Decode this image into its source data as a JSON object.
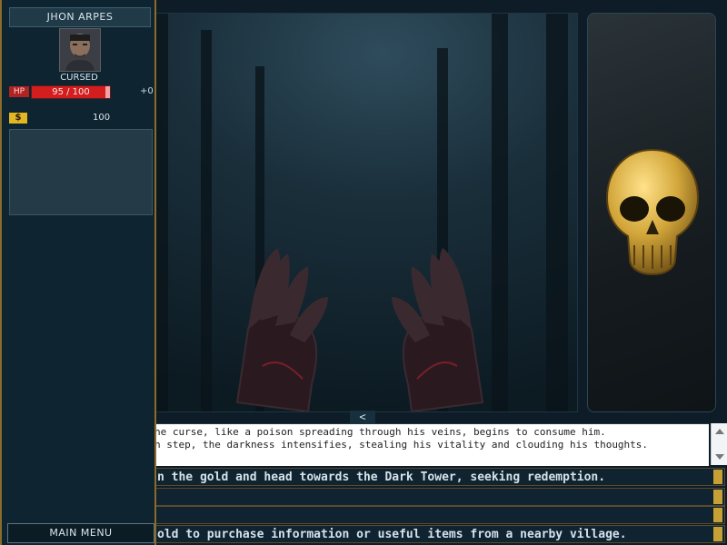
{
  "character": {
    "name": "JHON ARPES",
    "status": "CURSED",
    "hp": {
      "label": "HP",
      "current": 95,
      "max": 100,
      "text": "95 / 100",
      "delta": "+0"
    },
    "gold": {
      "symbol": "$",
      "value": "100"
    }
  },
  "navigation": {
    "main_menu": "MAIN MENU",
    "collapse_symbol": "<"
  },
  "narrative": {
    "lines": [
      "he curse, like a poison spreading through his veins, begins to consume him.",
      "n step, the darkness intensifies, stealing his vitality and clouding his thoughts."
    ]
  },
  "choices": [
    {
      "text": "n the gold and head towards the Dark Tower, seeking redemption."
    },
    {
      "text": ""
    },
    {
      "text": ""
    },
    {
      "text": "old to purchase information or useful items from a nearby village."
    }
  ],
  "scene": {
    "icon": "golden-skull-icon",
    "background": "#1a2f3b"
  },
  "colors": {
    "accent_gold": "#c6a035",
    "hp_red": "#d21e1e",
    "sidebar_bg": "#0e2430"
  }
}
